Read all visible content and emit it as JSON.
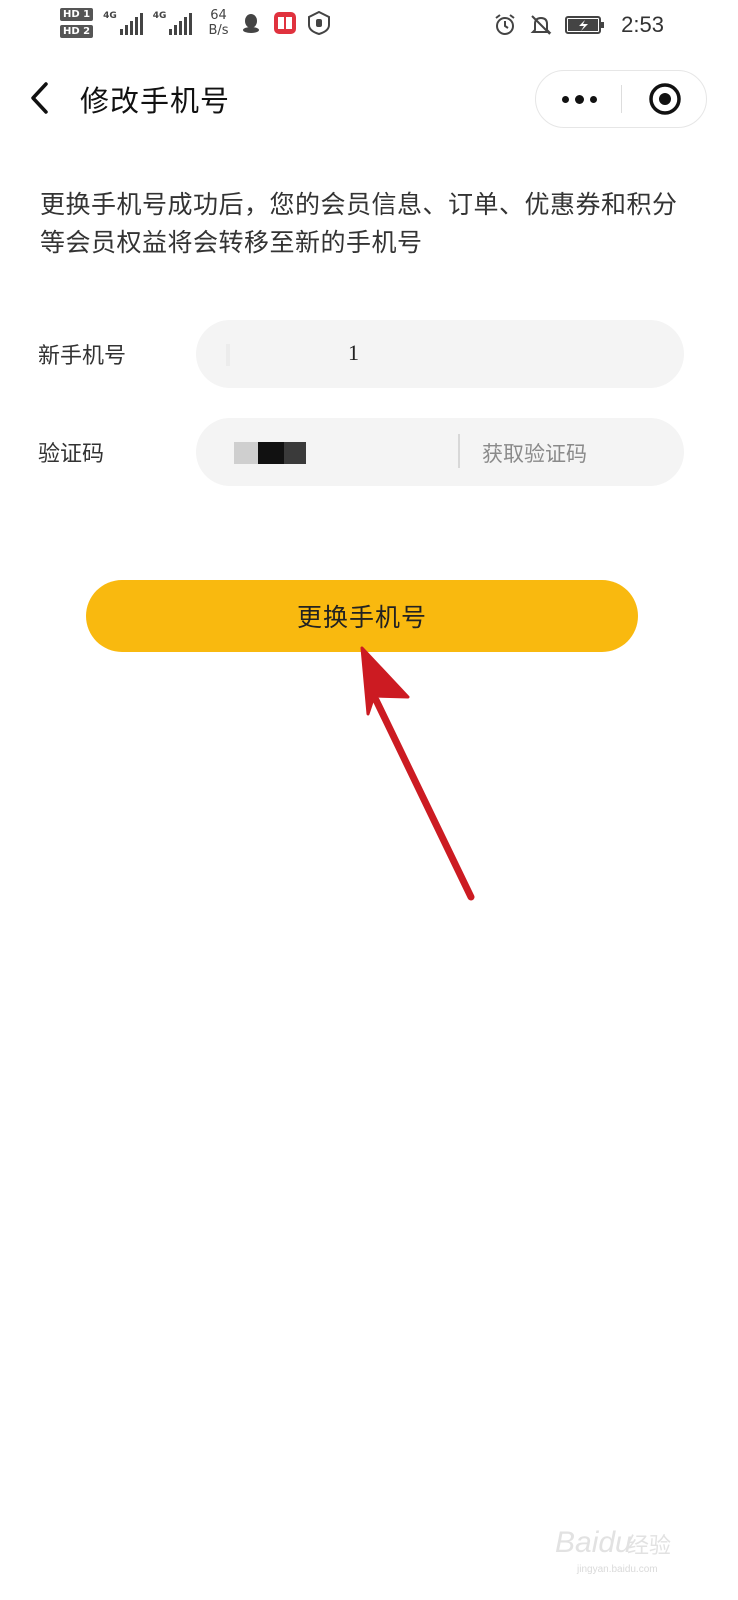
{
  "status_bar": {
    "sim1_badge": "HD",
    "sim1_sub": "1",
    "sim2_badge": "HD",
    "sim2_sub": "2",
    "signal1_type": "4G",
    "signal2_type": "4G",
    "net_speed_value": "64",
    "net_speed_unit": "B/s",
    "time": "2:53",
    "icons": [
      "qq-icon",
      "reader-app-icon",
      "shield-hand-icon",
      "alarm-icon",
      "mute-bell-icon",
      "battery-charging-icon"
    ]
  },
  "nav": {
    "title": "修改手机号",
    "back_icon": "chevron-left-icon",
    "more_icon": "more-dots-icon",
    "close_icon": "target-close-icon"
  },
  "notice": "更换手机号成功后，您的会员信息、订单、优惠券和积分等会员权益将会转移至新的手机号",
  "form": {
    "phone_label": "新手机号",
    "phone_value": "1",
    "code_label": "验证码",
    "get_code_button": "获取验证码"
  },
  "submit_button": "更换手机号",
  "colors": {
    "primary": "#f9b90f",
    "field_bg": "#f4f4f4",
    "annotation_arrow": "#cc1b22"
  },
  "watermark": {
    "brand": "Baidu",
    "jingyan": "经验",
    "url": "jingyan.baidu.com"
  }
}
